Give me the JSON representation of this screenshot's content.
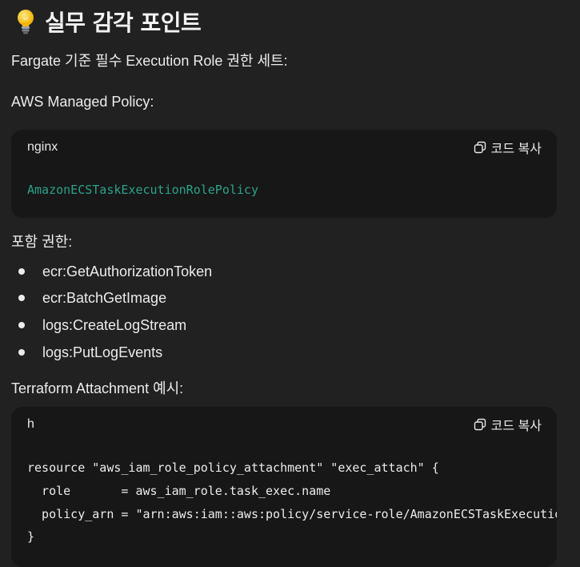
{
  "heading": {
    "emoji": "💡",
    "title": "실무 감각 포인트"
  },
  "intro": "Fargate 기준 필수 Execution Role 권한 세트:",
  "managed_label": "AWS Managed Policy:",
  "code_block_1": {
    "language": "nginx",
    "copy_label": "코드 복사",
    "code": "AmazonECSTaskExecutionRolePolicy"
  },
  "included_label": "포함 권한:",
  "permissions": [
    "ecr:GetAuthorizationToken",
    "ecr:BatchGetImage",
    "logs:CreateLogStream",
    "logs:PutLogEvents"
  ],
  "terraform_label": "Terraform Attachment 예시:",
  "code_block_2": {
    "language": "h",
    "copy_label": "코드 복사",
    "lines": [
      "resource \"aws_iam_role_policy_attachment\" \"exec_attach\" {",
      "  role       = aws_iam_role.task_exec.name",
      "  policy_arn = \"arn:aws:iam::aws:policy/service-role/AmazonECSTaskExecutionRolePolicy\"",
      "}"
    ]
  },
  "colors": {
    "background": "#212121",
    "code_background": "#171717",
    "policy_text": "#2ba38a"
  }
}
